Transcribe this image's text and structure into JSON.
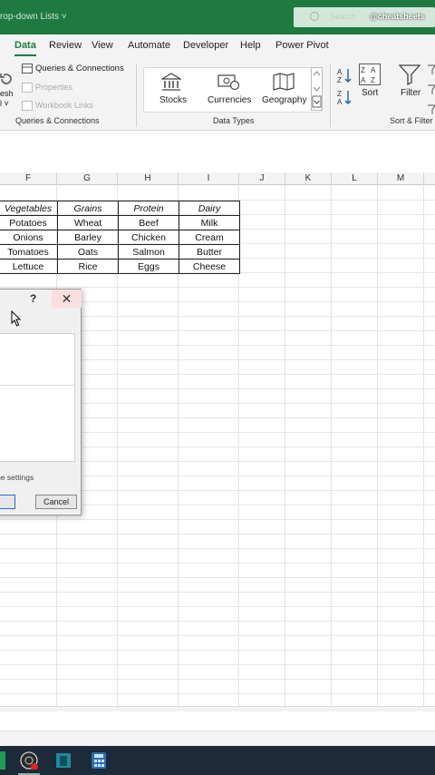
{
  "titlebar": {
    "doc_title": "rop-down Lists ˅",
    "search_placeholder": "Search",
    "watermark": "@cheatsheets"
  },
  "tabs": [
    "Data",
    "Review",
    "View",
    "Automate",
    "Developer",
    "Help",
    "Power Pivot"
  ],
  "ribbon": {
    "refresh_label": "esh",
    "refresh_sub": "l ˅",
    "queries_connections": "Queries & Connections",
    "properties": "Properties",
    "workbook_links": "Workbook Links",
    "group_queries": "Queries & Connections",
    "stocks": "Stocks",
    "currencies": "Currencies",
    "geography": "Geography",
    "group_datatypes": "Data Types",
    "sort": "Sort",
    "filter": "Filter",
    "group_sortfilter": "Sort & Filter"
  },
  "columns": [
    "F",
    "G",
    "H",
    "I",
    "J",
    "K",
    "L",
    "M"
  ],
  "table": {
    "headers": [
      "Vegetables",
      "Grains",
      "Protein",
      "Dairy"
    ],
    "rows": [
      [
        "Potatoes",
        "Wheat",
        "Beef",
        "Milk"
      ],
      [
        "Onions",
        "Barley",
        "Chicken",
        "Cream"
      ],
      [
        "Tomatoes",
        "Oats",
        "Salmon",
        "Butter"
      ],
      [
        "Lettuce",
        "Rice",
        "Eggs",
        "Cheese"
      ]
    ]
  },
  "dialog": {
    "help": "?",
    "close": "✕",
    "settings_text": "ame settings",
    "cancel": "Cancel"
  },
  "colors": {
    "brand": "#1f7a41",
    "taskbar": "#1c2a3a"
  }
}
